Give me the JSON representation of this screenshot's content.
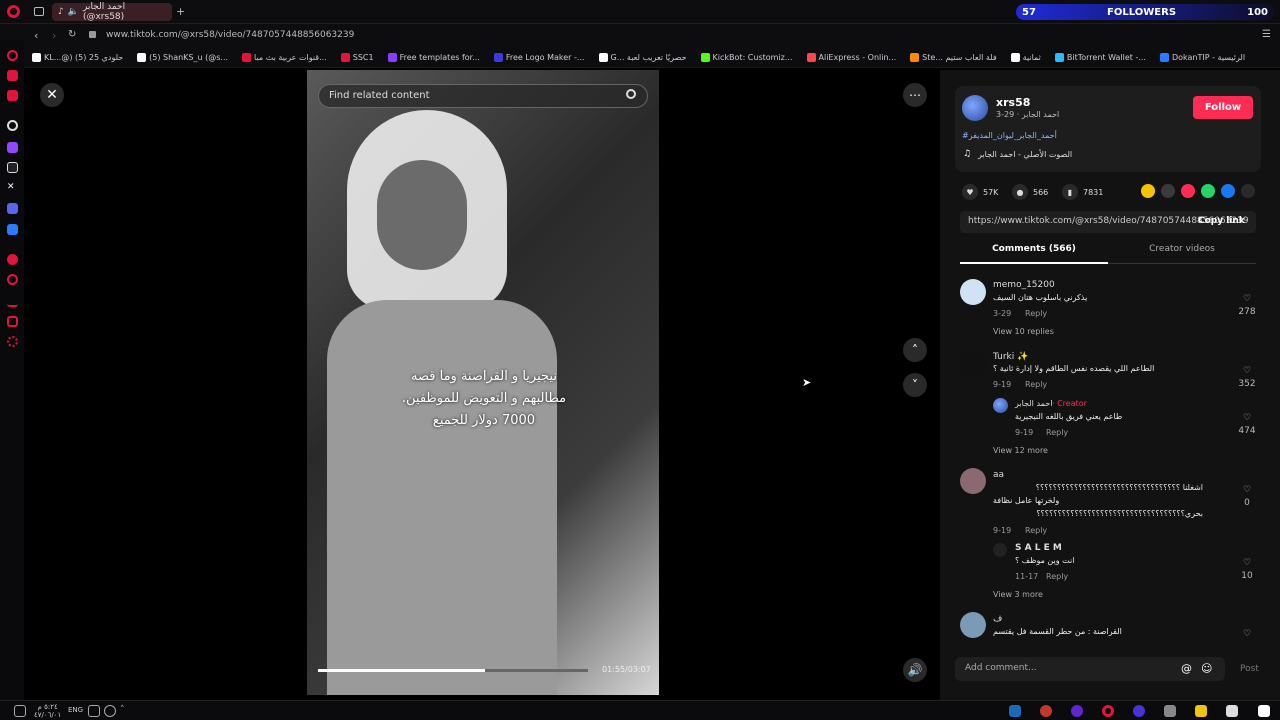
{
  "browser": {
    "tab_title": "احمد الجابر (@xrs58)",
    "url": "www.tiktok.com/@xrs58/video/7487057448856063239",
    "followers_widget": {
      "count": "57",
      "label": "FOLLOWERS",
      "goal": "100"
    },
    "bookmarks": [
      {
        "label": "KL...@) حلودي 25 (5)",
        "color": "#ffffff"
      },
      {
        "label": "(5) ShanKS_u (@s...",
        "color": "#ffffff"
      },
      {
        "label": "قنوات عربية بث مبا...",
        "color": "#e0143c"
      },
      {
        "label": "SSC1",
        "color": "#e0143c"
      },
      {
        "label": "Free templates for...",
        "color": "#8b3dff"
      },
      {
        "label": "Free Logo Maker -...",
        "color": "#3b3bd8"
      },
      {
        "label": "G... حصريًا تعريب لعبة",
        "color": "#ffffff"
      },
      {
        "label": "KickBot: Customiz...",
        "color": "#53fc18"
      },
      {
        "label": "AliExpress - Onlin...",
        "color": "#ff4747"
      },
      {
        "label": "Ste... فلة العاب ستيم",
        "color": "#ff8c00"
      },
      {
        "label": "ثمانية",
        "color": "#ffffff"
      },
      {
        "label": "BitTorrent Wallet -...",
        "color": "#2fb7ff"
      },
      {
        "label": "DokanTIP - الرئيسية",
        "color": "#2a7bff"
      }
    ]
  },
  "video": {
    "search_placeholder": "Find related content",
    "caption_lines": [
      "نيجيريا و القراصنة وما قصه",
      "مطالبهم و التعويض للموظفين.",
      "7000 دولار للجميع"
    ],
    "timecode": "01:55/03:07",
    "progress_fraction": 0.62
  },
  "author": {
    "username": "xrs58",
    "subtitle": "3-29 · احمد الجابر",
    "hashtag": "#أحمد_الجابر_ليوان_المديفر",
    "sound": "الصوت الأصلي - احمد الجابر",
    "follow_label": "Follow"
  },
  "stats": {
    "likes": "57K",
    "comments": "566",
    "saves": "7831"
  },
  "share_colors": [
    "#f5c400",
    "#3a3a3a",
    "#fe2c55",
    "#25d366",
    "#1877f2",
    "#2a2a2a"
  ],
  "link": {
    "url": "https://www.tiktok.com/@xrs58/video/7487057448856063239",
    "copy_label": "Copy link"
  },
  "tabs": {
    "comments": "Comments (566)",
    "creator": "Creator videos"
  },
  "comments": [
    {
      "name": "memo_15200",
      "text": "يذكرني باسلوب هتان السيف",
      "date": "3-29",
      "reply": "Reply",
      "likes": "278",
      "more": "View 10 replies"
    },
    {
      "name": "Turki ✨",
      "text": "الطاعم اللي يقصده نفس الطاقم ولا إدارة ثانية ؟",
      "date": "9-19",
      "reply": "Reply",
      "likes": "352"
    },
    {
      "name": "احمد الجابر",
      "creator_tag": "· Creator",
      "text": "طاعم يعني فريق باللغه النيجيرية",
      "date": "9-19",
      "reply": "Reply",
      "likes": "474",
      "more": "View 12 more"
    },
    {
      "name": "aa",
      "text_line1": "اشغلنا ؟؟؟؟؟؟؟؟؟؟؟؟؟؟؟؟؟؟؟؟؟؟؟؟؟؟؟؟؟؟؟؟؟؟",
      "text_line2": "ولخرتها عامل نظافة",
      "text_line3": "بحري؟؟؟؟؟؟؟؟؟؟؟؟؟؟؟؟؟؟؟؟؟؟؟؟؟؟؟؟؟؟؟؟؟؟؟",
      "date": "9-19",
      "reply": "Reply",
      "likes": "0"
    },
    {
      "name": "S A L E M",
      "text": "انت وين موظف ؟",
      "date": "11-17",
      "reply": "Reply",
      "likes": "10",
      "more": "View 3 more"
    },
    {
      "name": "ف",
      "text": "القراصنة : من حطر القسمة فل يقتسم",
      "likes": ""
    }
  ],
  "comment_input": {
    "placeholder": "Add comment...",
    "post": "Post"
  },
  "taskbar": {
    "time": "٥:٢٤ م",
    "date": "٤٧/٠٦/٠١",
    "lang": "ENG"
  }
}
